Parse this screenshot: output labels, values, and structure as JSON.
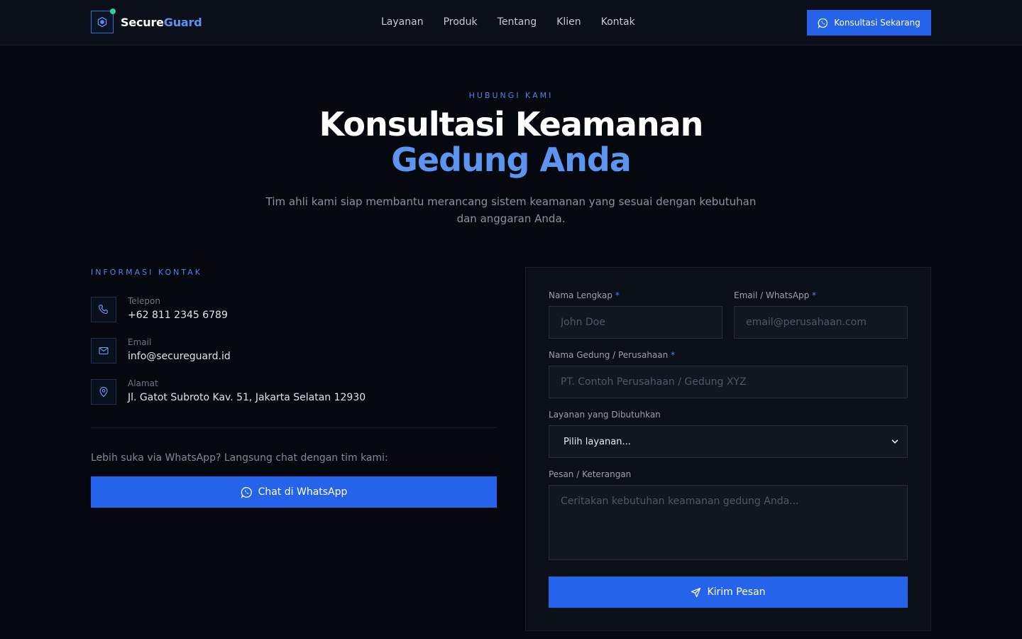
{
  "brand": {
    "name_part1": "Secure",
    "name_part2": "Guard"
  },
  "nav": {
    "links": [
      "Layanan",
      "Produk",
      "Tentang",
      "Klien",
      "Kontak"
    ],
    "cta_label": "Konsultasi Sekarang"
  },
  "hero": {
    "eyebrow": "HUBUNGI KAMI",
    "title_line1": "Konsultasi Keamanan",
    "title_line2": "Gedung Anda",
    "subtitle": "Tim ahli kami siap membantu merancang sistem keamanan yang sesuai dengan kebutuhan dan anggaran Anda."
  },
  "contact": {
    "heading": "INFORMASI KONTAK",
    "items": [
      {
        "label": "Telepon",
        "value": "+62 811 2345 6789",
        "icon": "phone-icon"
      },
      {
        "label": "Email",
        "value": "info@secureguard.id",
        "icon": "mail-icon"
      },
      {
        "label": "Alamat",
        "value": "Jl. Gatot Subroto Kav. 51, Jakarta Selatan 12930",
        "icon": "map-pin-icon"
      }
    ],
    "wa_note": "Lebih suka via WhatsApp? Langsung chat dengan tim kami:",
    "wa_button": "Chat di WhatsApp"
  },
  "form": {
    "name_label": "Nama Lengkap",
    "name_placeholder": "John Doe",
    "email_label": "Email / WhatsApp",
    "email_placeholder": "email@perusahaan.com",
    "building_label": "Nama Gedung / Perusahaan",
    "building_placeholder": "PT. Contoh Perusahaan / Gedung XYZ",
    "service_label": "Layanan yang Dibutuhkan",
    "service_selected": "Pilih layanan...",
    "message_label": "Pesan / Keterangan",
    "message_placeholder": "Ceritakan kebutuhan keamanan gedung Anda...",
    "required_mark": "*",
    "submit_label": "Kirim Pesan"
  },
  "colors": {
    "accent": "#2563eb",
    "accent_text": "#5b95ef",
    "background": "#05080f",
    "status_dot": "#2ed39a"
  }
}
